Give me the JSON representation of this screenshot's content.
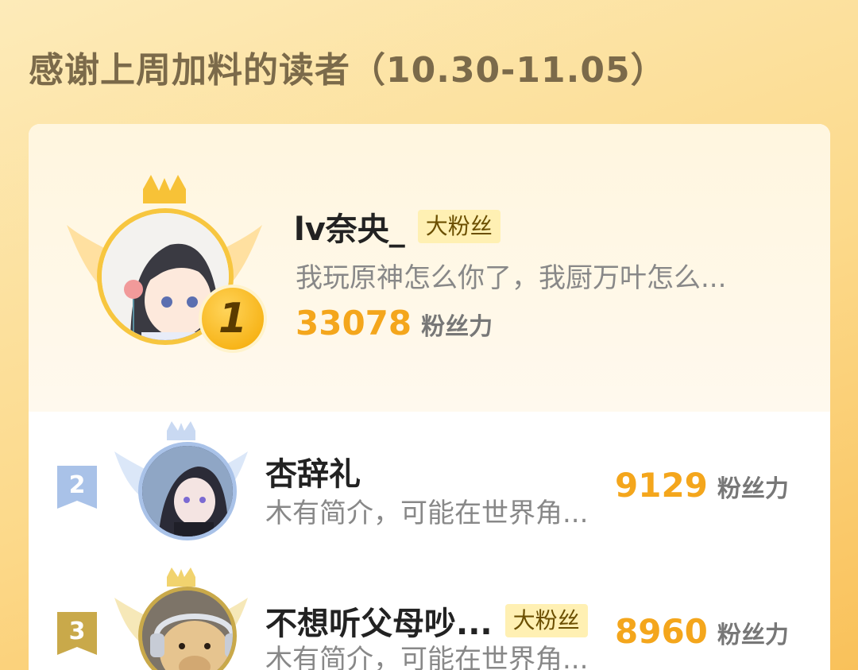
{
  "header": {
    "title": "感谢上周加料的读者（10.30-11.05）"
  },
  "ranking": [
    {
      "rank": "1",
      "name": "lv奈央_",
      "tag": "大粉丝",
      "desc": "我玩原神怎么你了，我厨万叶怎么...",
      "score": "33078",
      "score_label": "粉丝力"
    },
    {
      "rank": "2",
      "name": "杏辞礼",
      "tag": "",
      "desc": "木有简介，可能在世界角...",
      "score": "9129",
      "score_label": "粉丝力"
    },
    {
      "rank": "3",
      "name": "不想听父母吵...",
      "tag": "大粉丝",
      "desc": "木有简介，可能在世界角...",
      "score": "8960",
      "score_label": "粉丝力"
    }
  ],
  "colors": {
    "accent": "#f4a61c",
    "gold": "#f4c23a",
    "silver": "#a9c2e8",
    "bronze": "#c9a94a"
  },
  "icons": [
    "crown-icon",
    "wings-icon",
    "avatar",
    "rank-badge-icon"
  ]
}
